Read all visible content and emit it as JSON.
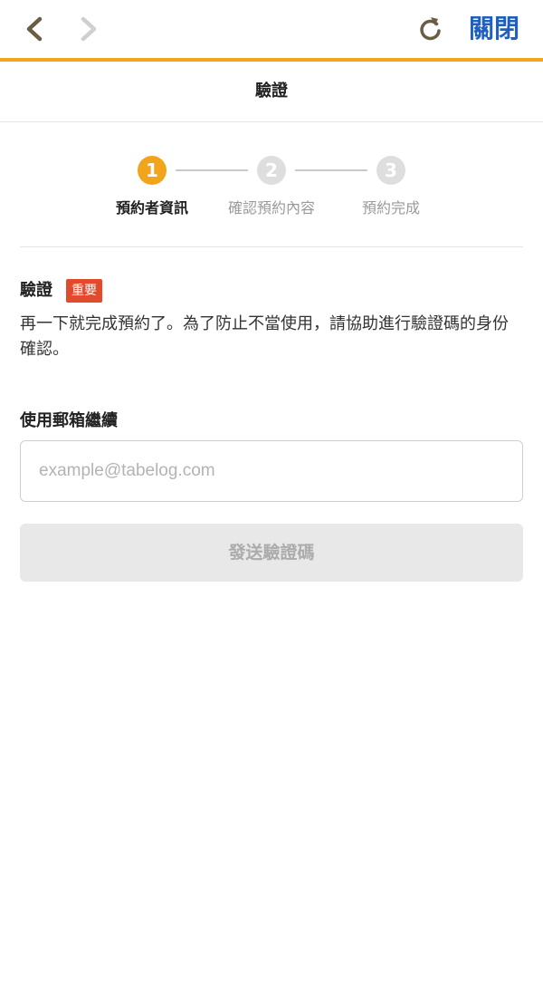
{
  "browser_bar": {
    "back_icon": "chevron-left-icon",
    "forward_icon": "chevron-right-icon",
    "reload_icon": "reload-icon",
    "close_label": "關閉",
    "accent_color": "#f2a41a",
    "close_color": "#1f5fbf"
  },
  "header": {
    "title": "驗證"
  },
  "stepper": {
    "steps": [
      {
        "number": "1",
        "label": "預約者資訊",
        "state": "active"
      },
      {
        "number": "2",
        "label": "確認預約內容",
        "state": "inactive"
      },
      {
        "number": "3",
        "label": "預約完成",
        "state": "inactive"
      }
    ],
    "active_color": "#f2a41a",
    "inactive_color": "#dedede"
  },
  "verification": {
    "title": "驗證",
    "badge": "重要",
    "badge_color": "#e24a2e",
    "description": "再一下就完成預約了。為了防止不當使用，請協助進行驗證碼的身份確認。"
  },
  "email": {
    "label": "使用郵箱繼續",
    "placeholder": "example@tabelog.com",
    "value": ""
  },
  "send_button": {
    "label": "發送驗證碼",
    "state": "disabled"
  }
}
